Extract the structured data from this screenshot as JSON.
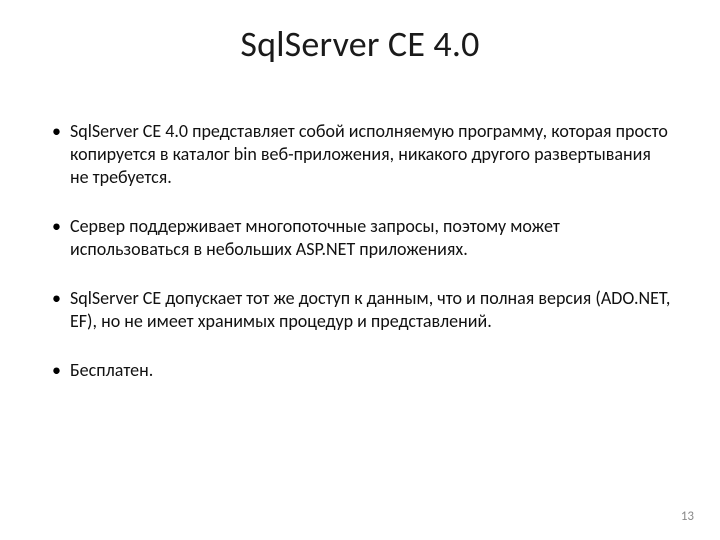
{
  "slide": {
    "title": "SqlServer CE 4.0",
    "bullets": [
      "SqlServer CE 4.0 представляет собой исполняемую программу, которая просто копируется в каталог bin веб-приложения, никакого другого развертывания не требуется.",
      "Сервер поддерживает многопоточные запросы, поэтому может использоваться в небольших ASP.NET приложениях.",
      "SqlServer CE допускает тот же доступ к данным, что и полная версия (ADO.NET, EF), но не имеет хранимых процедур и представлений.",
      "Бесплатен."
    ],
    "page_number": "13"
  }
}
